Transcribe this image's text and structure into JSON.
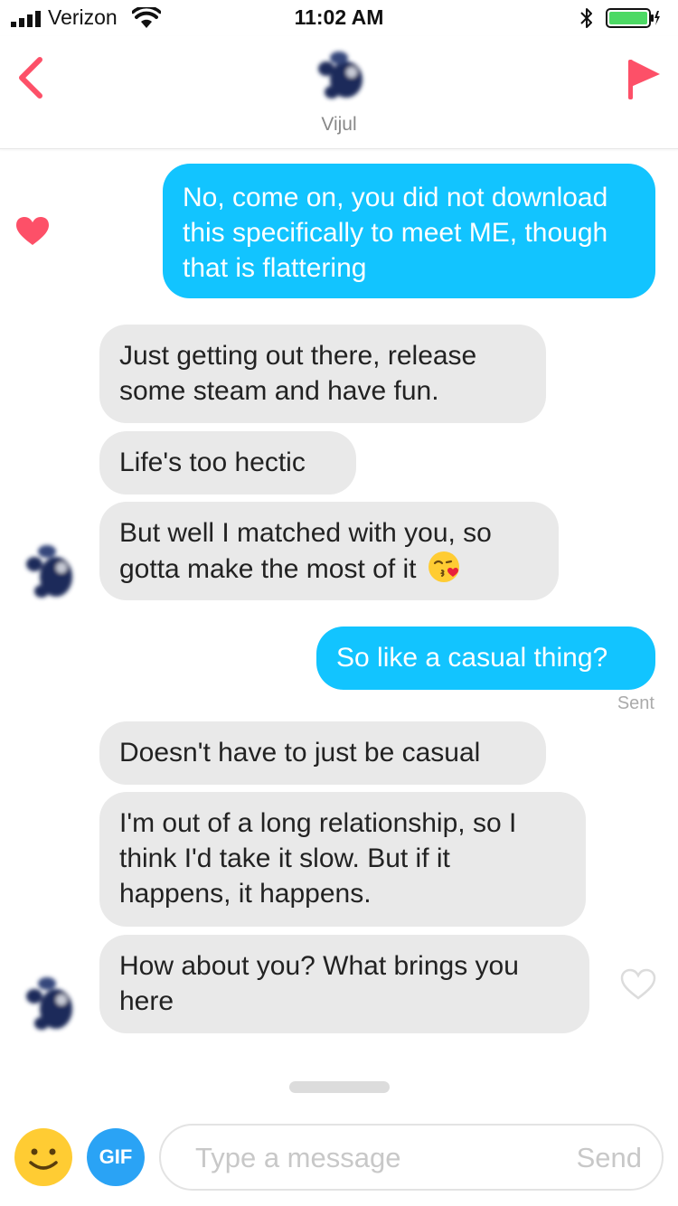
{
  "status_bar": {
    "carrier": "Verizon",
    "time": "11:02 AM"
  },
  "header": {
    "name": "Vijul"
  },
  "messages": [
    {
      "text": "No, come on, you did not download this specifically to meet ME, though that is flattering",
      "direction": "outgoing",
      "liked": true
    },
    {
      "text": "Just getting out there, release some steam and have fun.",
      "direction": "incoming"
    },
    {
      "text": "Life's too hectic",
      "direction": "incoming"
    },
    {
      "text": "But well I matched with you, so gotta make the most of it",
      "direction": "incoming",
      "emoji": "kissing-heart-emoji"
    },
    {
      "text": "So like a casual thing?",
      "direction": "outgoing",
      "status": "Sent"
    },
    {
      "text": "Doesn't have to just be casual",
      "direction": "incoming"
    },
    {
      "text": "I'm out of a long relationship, so I think I'd take it slow. But if it happens, it happens.",
      "direction": "incoming"
    },
    {
      "text": "How about you? What brings you here",
      "direction": "incoming",
      "liked": false
    }
  ],
  "composer": {
    "gif_label": "GIF",
    "placeholder": "Type a message",
    "send_label": "Send"
  },
  "colors": {
    "accent": "#fd5068",
    "outgoing_bubble": "#12c4ff",
    "incoming_bubble": "#e9e9e9",
    "gif_button": "#2aa3f5"
  },
  "icons": [
    "signal-icon",
    "wifi-icon",
    "bluetooth-icon",
    "battery-icon",
    "back-chevron-icon",
    "flag-icon",
    "heart-icon",
    "heart-outline-icon",
    "smiley-icon"
  ]
}
